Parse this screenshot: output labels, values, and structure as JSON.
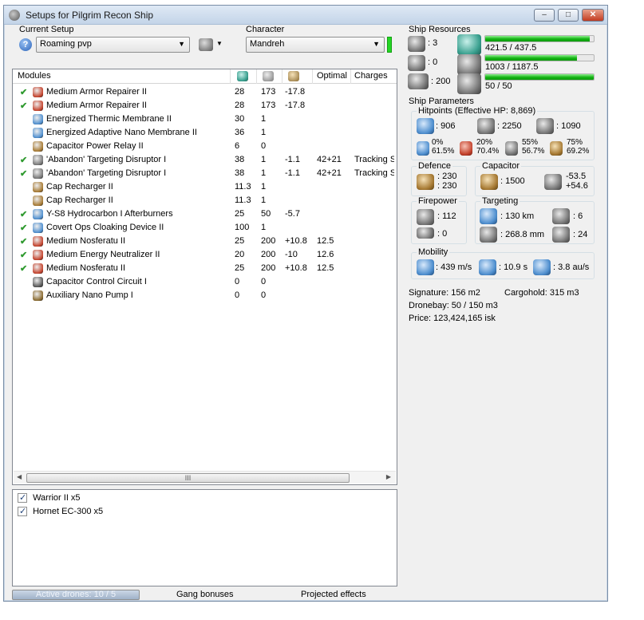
{
  "window": {
    "title": "Setups for Pilgrim Recon Ship",
    "controls": {
      "minimize": "–",
      "maximize": "□",
      "close": "✕"
    }
  },
  "setup": {
    "label": "Current Setup",
    "value": "Roaming pvp",
    "help_icon": "?"
  },
  "character": {
    "label": "Character",
    "value": "Mandreh",
    "indicator_color": "#24d624"
  },
  "modules": {
    "columns": [
      "Modules",
      "",
      "",
      "",
      "Optimal",
      "Charges"
    ],
    "rows": [
      {
        "fitted": true,
        "name": "Medium Armor Repairer II",
        "cpu": "28",
        "pg": "173",
        "cap": "-17.8",
        "optimal": "",
        "charges": ""
      },
      {
        "fitted": true,
        "name": "Medium Armor Repairer II",
        "cpu": "28",
        "pg": "173",
        "cap": "-17.8",
        "optimal": "",
        "charges": ""
      },
      {
        "fitted": false,
        "name": "Energized Thermic Membrane II",
        "cpu": "30",
        "pg": "1",
        "cap": "",
        "optimal": "",
        "charges": ""
      },
      {
        "fitted": false,
        "name": "Energized Adaptive Nano Membrane II",
        "cpu": "36",
        "pg": "1",
        "cap": "",
        "optimal": "",
        "charges": ""
      },
      {
        "fitted": false,
        "name": "Capacitor Power Relay II",
        "cpu": "6",
        "pg": "0",
        "cap": "",
        "optimal": "",
        "charges": ""
      },
      {
        "fitted": true,
        "name": "'Abandon' Targeting Disruptor I",
        "cpu": "38",
        "pg": "1",
        "cap": "-1.1",
        "optimal": "42+21",
        "charges": "Tracking S"
      },
      {
        "fitted": true,
        "name": "'Abandon' Targeting Disruptor I",
        "cpu": "38",
        "pg": "1",
        "cap": "-1.1",
        "optimal": "42+21",
        "charges": "Tracking S"
      },
      {
        "fitted": false,
        "name": "Cap Recharger II",
        "cpu": "11.3",
        "pg": "1",
        "cap": "",
        "optimal": "",
        "charges": ""
      },
      {
        "fitted": false,
        "name": "Cap Recharger II",
        "cpu": "11.3",
        "pg": "1",
        "cap": "",
        "optimal": "",
        "charges": ""
      },
      {
        "fitted": true,
        "name": "Y-S8 Hydrocarbon I Afterburners",
        "cpu": "25",
        "pg": "50",
        "cap": "-5.7",
        "optimal": "",
        "charges": ""
      },
      {
        "fitted": true,
        "name": "Covert Ops Cloaking Device II",
        "cpu": "100",
        "pg": "1",
        "cap": "",
        "optimal": "",
        "charges": ""
      },
      {
        "fitted": true,
        "name": "Medium Nosferatu II",
        "cpu": "25",
        "pg": "200",
        "cap": "+10.8",
        "optimal": "12.5",
        "charges": ""
      },
      {
        "fitted": true,
        "name": "Medium Energy Neutralizer II",
        "cpu": "20",
        "pg": "200",
        "cap": "-10",
        "optimal": "12.6",
        "charges": ""
      },
      {
        "fitted": true,
        "name": "Medium Nosferatu II",
        "cpu": "25",
        "pg": "200",
        "cap": "+10.8",
        "optimal": "12.5",
        "charges": ""
      },
      {
        "fitted": false,
        "name": "Capacitor Control Circuit I",
        "cpu": "0",
        "pg": "0",
        "cap": "",
        "optimal": "",
        "charges": ""
      },
      {
        "fitted": false,
        "name": "Auxiliary Nano Pump I",
        "cpu": "0",
        "pg": "0",
        "cap": "",
        "optimal": "",
        "charges": ""
      }
    ],
    "scroll_thumb_label": "III"
  },
  "drones": [
    {
      "checked": true,
      "name": "Warrior II x5"
    },
    {
      "checked": true,
      "name": "Hornet EC-300 x5"
    }
  ],
  "status": {
    "active_drones": "Active drones: 10 / 5",
    "gang_bonuses": "Gang bonuses",
    "projected_effects": "Projected effects"
  },
  "ship_resources": {
    "title": "Ship Resources",
    "turrets": ": 3",
    "launchers": ": 0",
    "calibration": ": 200",
    "cpu": {
      "text": "421.5 / 437.5",
      "fraction": 0.963
    },
    "powergrid": {
      "text": "1003 / 1187.5",
      "fraction": 0.845
    },
    "drone_bandwidth": {
      "text": "50 / 50",
      "fraction": 1.0
    }
  },
  "ship_parameters": {
    "title": "Ship Parameters",
    "hitpoints": {
      "title": "Hitpoints (Effective HP: 8,869)",
      "shield": ": 906",
      "armor": ": 2250",
      "structure": ": 1090",
      "resists": [
        {
          "a": "0%",
          "b": "61.5%"
        },
        {
          "a": "20%",
          "b": "70.4%"
        },
        {
          "a": "55%",
          "b": "56.7%"
        },
        {
          "a": "75%",
          "b": "69.2%"
        }
      ]
    },
    "defence": {
      "title": "Defence",
      "line1": ": 230",
      "line2": ": 230"
    },
    "capacitor": {
      "title": "Capacitor",
      "amount": ": 1500",
      "line1": "-53.5",
      "line2": "+54.6"
    },
    "firepower": {
      "title": "Firepower",
      "dps": ": 112",
      "volley": ": 0"
    },
    "targeting": {
      "title": "Targeting",
      "range": ": 130 km",
      "max_targets": ": 6",
      "scan_res": ": 268.8 mm",
      "sensor": ": 24"
    },
    "mobility": {
      "title": "Mobility",
      "speed": ": 439 m/s",
      "align": ": 10.9 s",
      "warp": ": 3.8 au/s"
    }
  },
  "ship_info": {
    "signature": "Signature: 156 m2",
    "cargohold": "Cargohold: 315 m3",
    "dronebay": "Dronebay: 50 / 150 m3",
    "price": "Price: 123,424,165 isk"
  }
}
